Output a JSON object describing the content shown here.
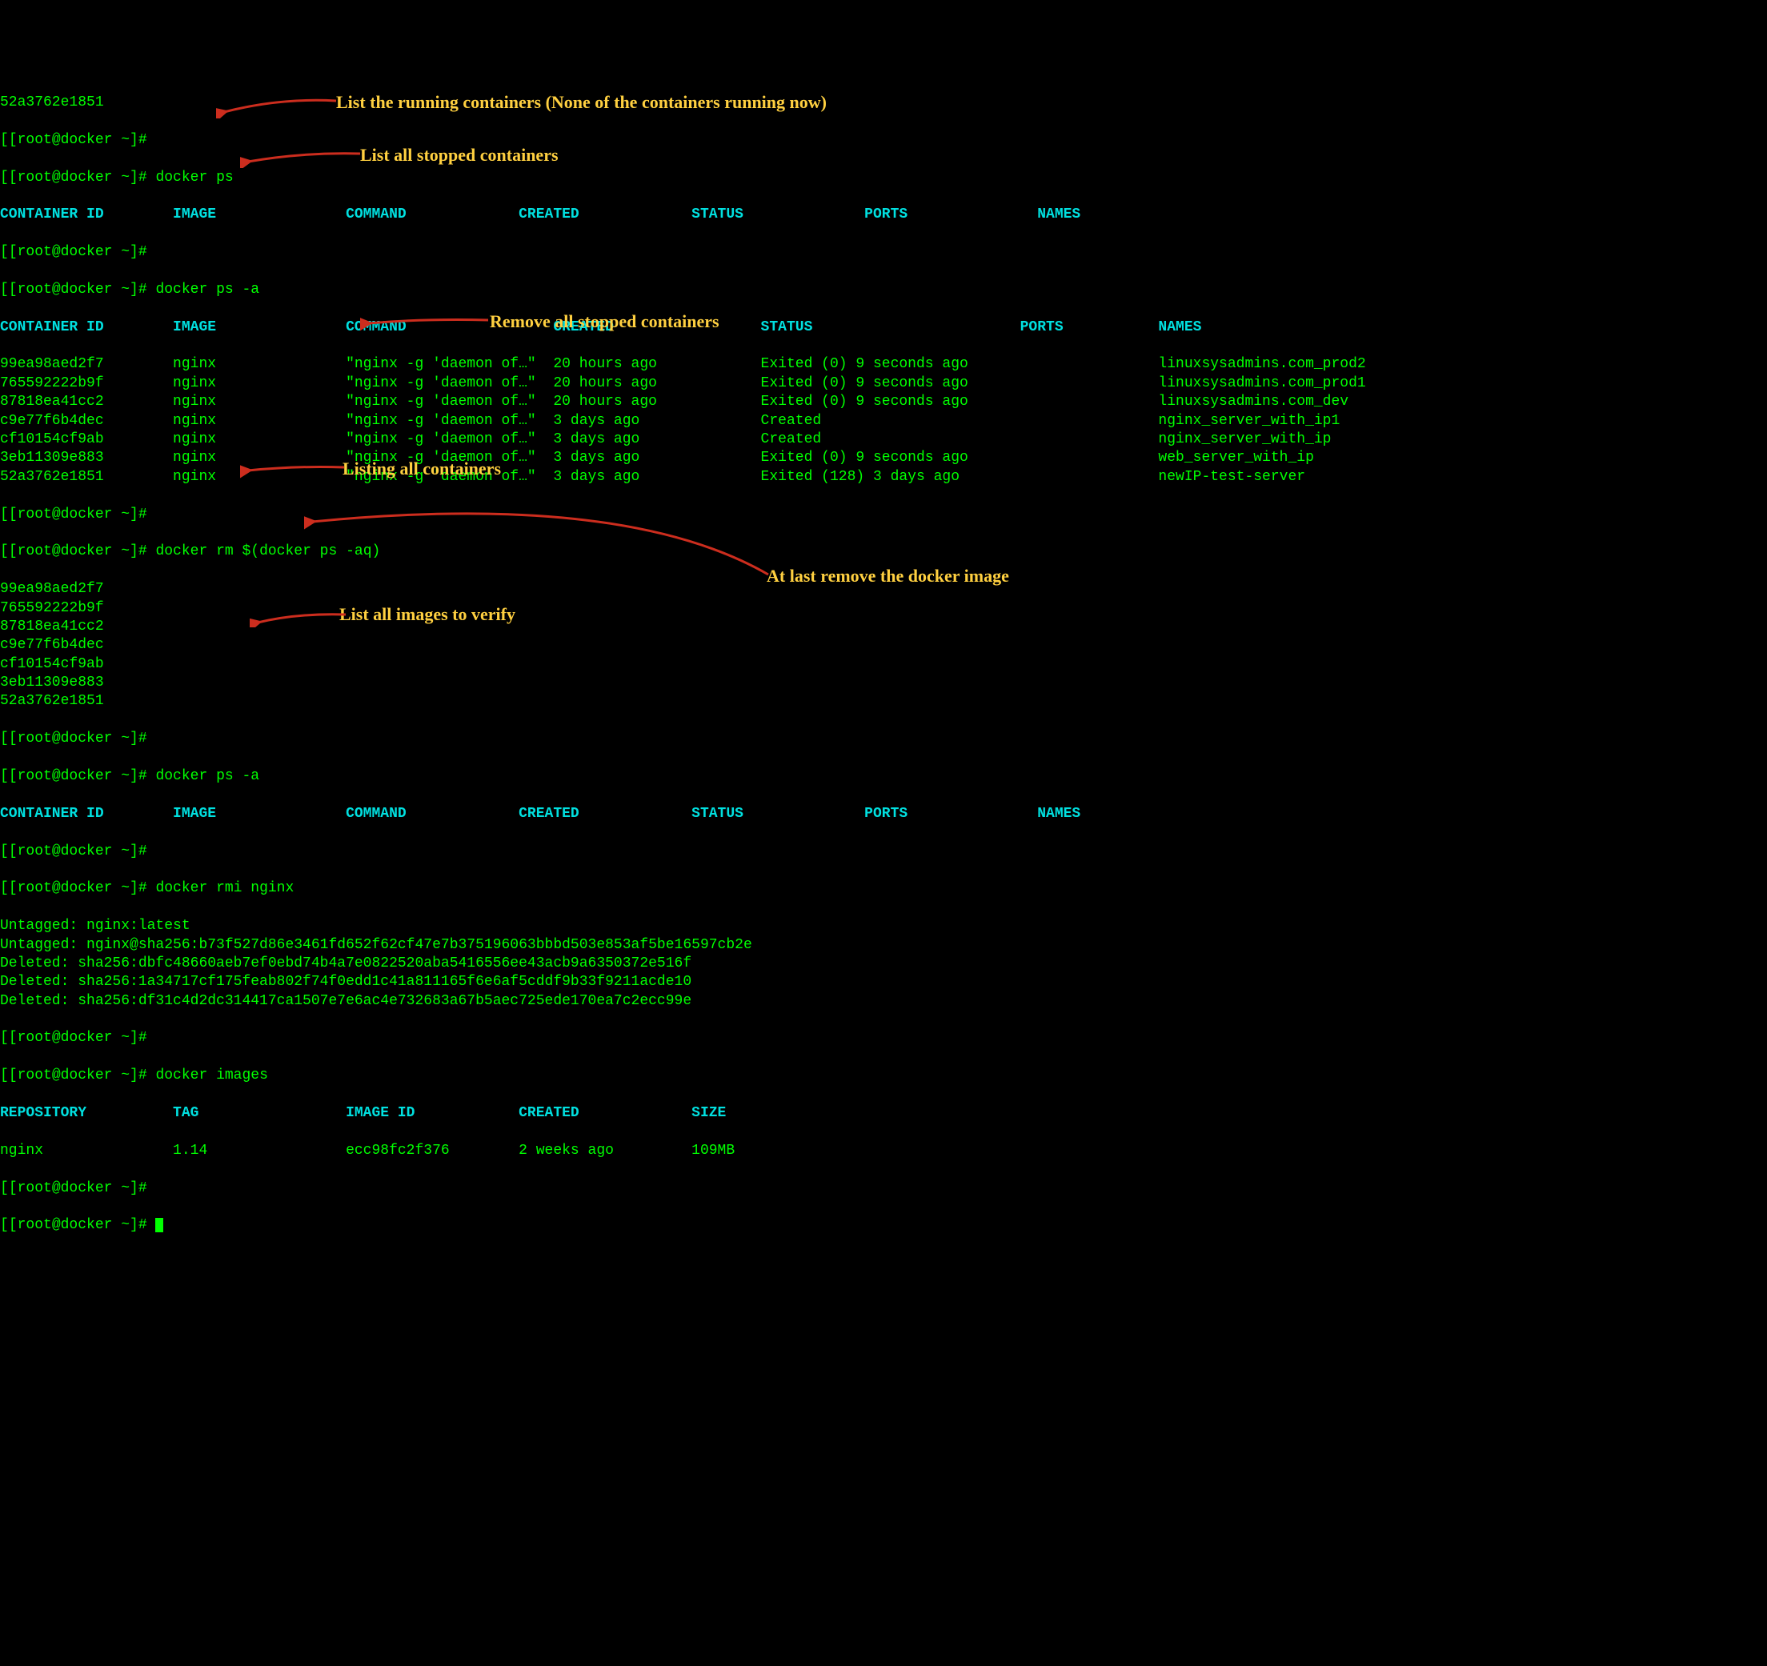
{
  "colors": {
    "term_fg": "#00ff00",
    "term_header": "#00e0e0",
    "annotation": "#ffd040",
    "arrow": "#cc2d1e",
    "bg": "#000000"
  },
  "prompt": "[root@docker ~]#",
  "fragment_top": "52a3762e1851",
  "commands": {
    "ps": "docker ps",
    "ps_a1": "docker ps -a",
    "rm_all": "docker rm $(docker ps -aq)",
    "ps_a2": "docker ps -a",
    "rmi": "docker rmi nginx",
    "images": "docker images"
  },
  "ps_headers": [
    "CONTAINER ID",
    "IMAGE",
    "COMMAND",
    "CREATED",
    "STATUS",
    "PORTS",
    "NAMES"
  ],
  "ps_a_rows": [
    {
      "id": "99ea98aed2f7",
      "image": "nginx",
      "command": "\"nginx -g 'daemon of…\"",
      "created": "20 hours ago",
      "status": "Exited (0) 9 seconds ago",
      "ports": "",
      "names": "linuxsysadmins.com_prod2"
    },
    {
      "id": "765592222b9f",
      "image": "nginx",
      "command": "\"nginx -g 'daemon of…\"",
      "created": "20 hours ago",
      "status": "Exited (0) 9 seconds ago",
      "ports": "",
      "names": "linuxsysadmins.com_prod1"
    },
    {
      "id": "87818ea41cc2",
      "image": "nginx",
      "command": "\"nginx -g 'daemon of…\"",
      "created": "20 hours ago",
      "status": "Exited (0) 9 seconds ago",
      "ports": "",
      "names": "linuxsysadmins.com_dev"
    },
    {
      "id": "c9e77f6b4dec",
      "image": "nginx",
      "command": "\"nginx -g 'daemon of…\"",
      "created": "3 days ago",
      "status": "Created",
      "ports": "",
      "names": "nginx_server_with_ip1"
    },
    {
      "id": "cf10154cf9ab",
      "image": "nginx",
      "command": "\"nginx -g 'daemon of…\"",
      "created": "3 days ago",
      "status": "Created",
      "ports": "",
      "names": "nginx_server_with_ip"
    },
    {
      "id": "3eb11309e883",
      "image": "nginx",
      "command": "\"nginx -g 'daemon of…\"",
      "created": "3 days ago",
      "status": "Exited (0) 9 seconds ago",
      "ports": "",
      "names": "web_server_with_ip"
    },
    {
      "id": "52a3762e1851",
      "image": "nginx",
      "command": "\"nginx -g 'daemon of…\"",
      "created": "3 days ago",
      "status": "Exited (128) 3 days ago",
      "ports": "",
      "names": "newIP-test-server"
    }
  ],
  "removed_ids": [
    "99ea98aed2f7",
    "765592222b9f",
    "87818ea41cc2",
    "c9e77f6b4dec",
    "cf10154cf9ab",
    "3eb11309e883",
    "52a3762e1851"
  ],
  "rmi_output": [
    "Untagged: nginx:latest",
    "Untagged: nginx@sha256:b73f527d86e3461fd652f62cf47e7b375196063bbbd503e853af5be16597cb2e",
    "Deleted: sha256:dbfc48660aeb7ef0ebd74b4a7e0822520aba5416556ee43acb9a6350372e516f",
    "Deleted: sha256:1a34717cf175feab802f74f0edd1c41a811165f6e6af5cddf9b33f9211acde10",
    "Deleted: sha256:df31c4d2dc314417ca1507e7e6ac4e732683a67b5aec725ede170ea7c2ecc99e"
  ],
  "images_headers": [
    "REPOSITORY",
    "TAG",
    "IMAGE ID",
    "CREATED",
    "SIZE"
  ],
  "images_rows": [
    {
      "repo": "nginx",
      "tag": "1.14",
      "id": "ecc98fc2f376",
      "created": "2 weeks ago",
      "size": "109MB"
    }
  ],
  "annotations": {
    "a1": "List the running containers (None of the containers running now)",
    "a2": "List all stopped containers",
    "a3": "Remove all stopped containers",
    "a4": "Listing all containers",
    "a5": "At last remove the docker image",
    "a6": "List all images to verify"
  }
}
